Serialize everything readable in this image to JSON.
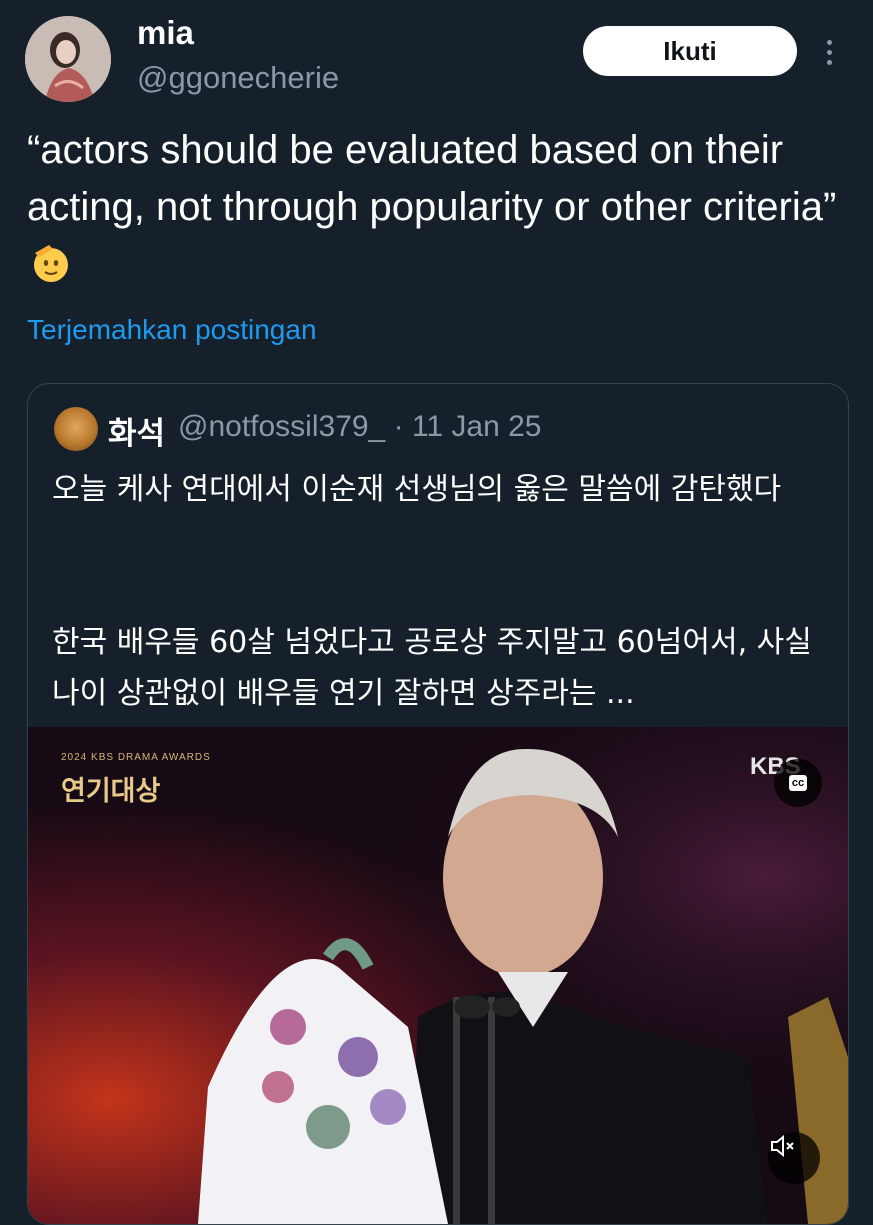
{
  "author": {
    "display_name": "mia",
    "handle": "@ggonecherie",
    "follow_label": "Ikuti"
  },
  "tweet": {
    "text": "“actors should be evaluated based on their acting, not through popularity or other criteria”",
    "emoji": "saluting-face",
    "translate_label": "Terjemahkan postingan"
  },
  "quote": {
    "name": "화석",
    "meta": "@notfossil379_ · 11 Jan 25",
    "text": "오늘 케사 연대에서 이순재 선생님의 옳은 말씀에 감탄했다\n\n\n한국 배우들 60살 넘었다고 공로상 주지말고 60넘어서, 사실 나이 상관없이 배우들 연기 잘하면 상주라는 ...",
    "media": {
      "overlay_small": "2024 KBS DRAMA AWARDS",
      "overlay_title": "연기대상",
      "channel_logo": "KBS",
      "cc_label": "cc",
      "mute_icon": "speaker-muted-icon"
    }
  },
  "colors": {
    "background": "#15202b",
    "link": "#1d9bf0",
    "muted": "#8b98a5"
  }
}
